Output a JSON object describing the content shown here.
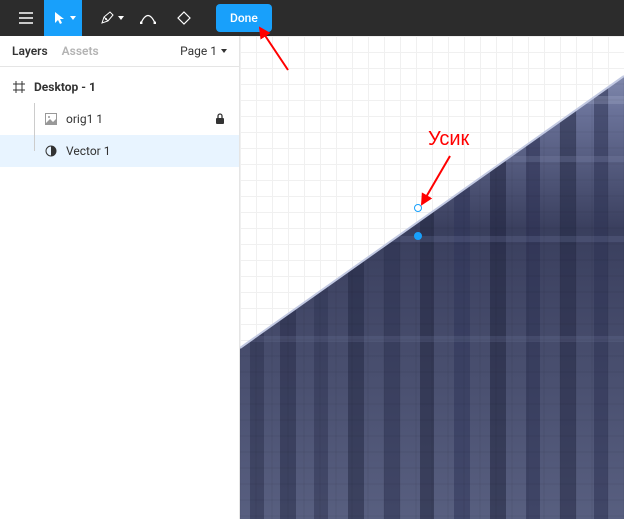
{
  "toolbar": {
    "done_label": "Done"
  },
  "sidebar": {
    "tabs": {
      "layers": "Layers",
      "assets": "Assets"
    },
    "page_label": "Page 1",
    "frame": {
      "name": "Desktop - 1"
    },
    "layers": [
      {
        "name": "orig1 1",
        "locked": true
      },
      {
        "name": "Vector 1",
        "selected": true
      }
    ]
  },
  "annotations": {
    "usik_label": "Усик"
  },
  "colors": {
    "accent": "#18a0fb",
    "annotation": "#ff0000"
  }
}
